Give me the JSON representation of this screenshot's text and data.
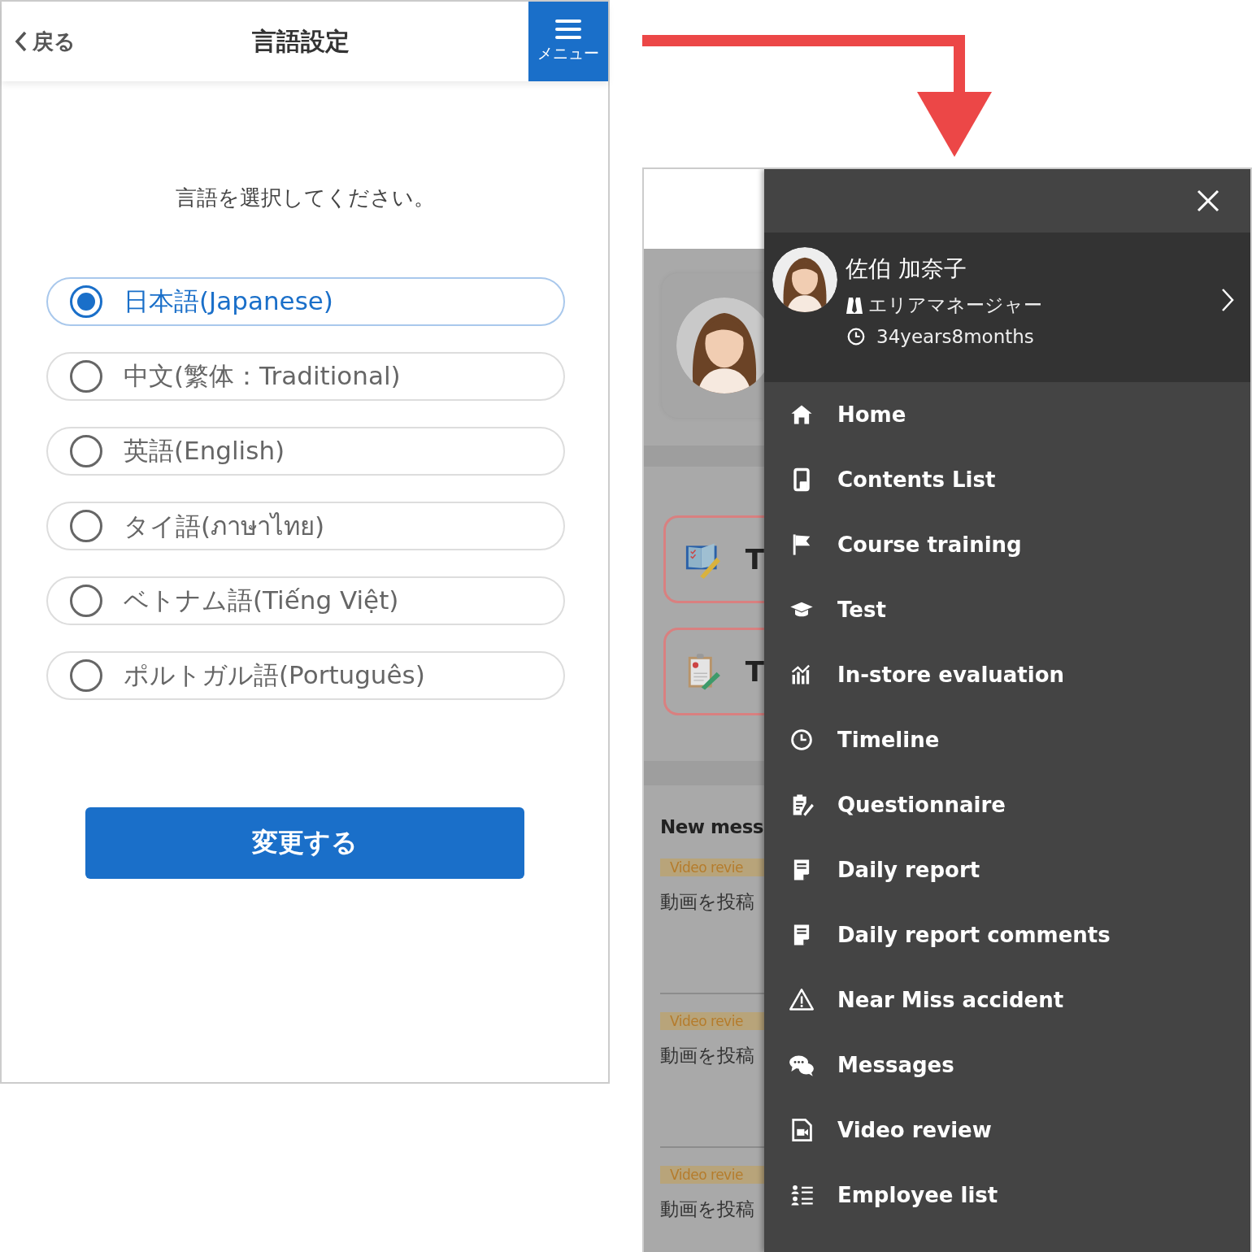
{
  "language_screen": {
    "back_label": "戻る",
    "title": "言語設定",
    "menu_label": "メニュー",
    "prompt": "言語を選択してください。",
    "options": [
      {
        "label": "日本語(Japanese)",
        "selected": true
      },
      {
        "label": "中文(繁体：Traditional)",
        "selected": false
      },
      {
        "label": "英語(English)",
        "selected": false
      },
      {
        "label": "タイ語(ภาษาไทย)",
        "selected": false
      },
      {
        "label": "ベトナム語(Tiếng Việt)",
        "selected": false
      },
      {
        "label": "ポルトガル語(Português)",
        "selected": false
      }
    ],
    "submit": "変更する"
  },
  "background_screen": {
    "cards": [
      {
        "kind": "book",
        "label": "T"
      },
      {
        "kind": "clipboard",
        "label": "T"
      }
    ],
    "section_title": "New mess",
    "messages": [
      {
        "tag": "Video revie",
        "text": "動画を投稿"
      },
      {
        "tag": "Video revie",
        "text": "動画を投稿"
      },
      {
        "tag": "Video revie",
        "text": "動画を投稿"
      }
    ]
  },
  "menu": {
    "profile": {
      "name": "佐伯 加奈子",
      "role": "エリアマネージャー",
      "tenure": "34years8months"
    },
    "items": [
      {
        "label": "Home",
        "kind": "home"
      },
      {
        "label": "Contents List",
        "kind": "device"
      },
      {
        "label": "Course training",
        "kind": "flag"
      },
      {
        "label": "Test",
        "kind": "cap"
      },
      {
        "label": "In-store evaluation",
        "kind": "chart"
      },
      {
        "label": "Timeline",
        "kind": "clock"
      },
      {
        "label": "Questionnaire",
        "kind": "survey"
      },
      {
        "label": "Daily report",
        "kind": "report"
      },
      {
        "label": "Daily report comments",
        "kind": "report"
      },
      {
        "label": "Near Miss accident",
        "kind": "warning"
      },
      {
        "label": "Messages",
        "kind": "chat"
      },
      {
        "label": "Video review",
        "kind": "video"
      },
      {
        "label": "Employee list",
        "kind": "list"
      }
    ]
  }
}
